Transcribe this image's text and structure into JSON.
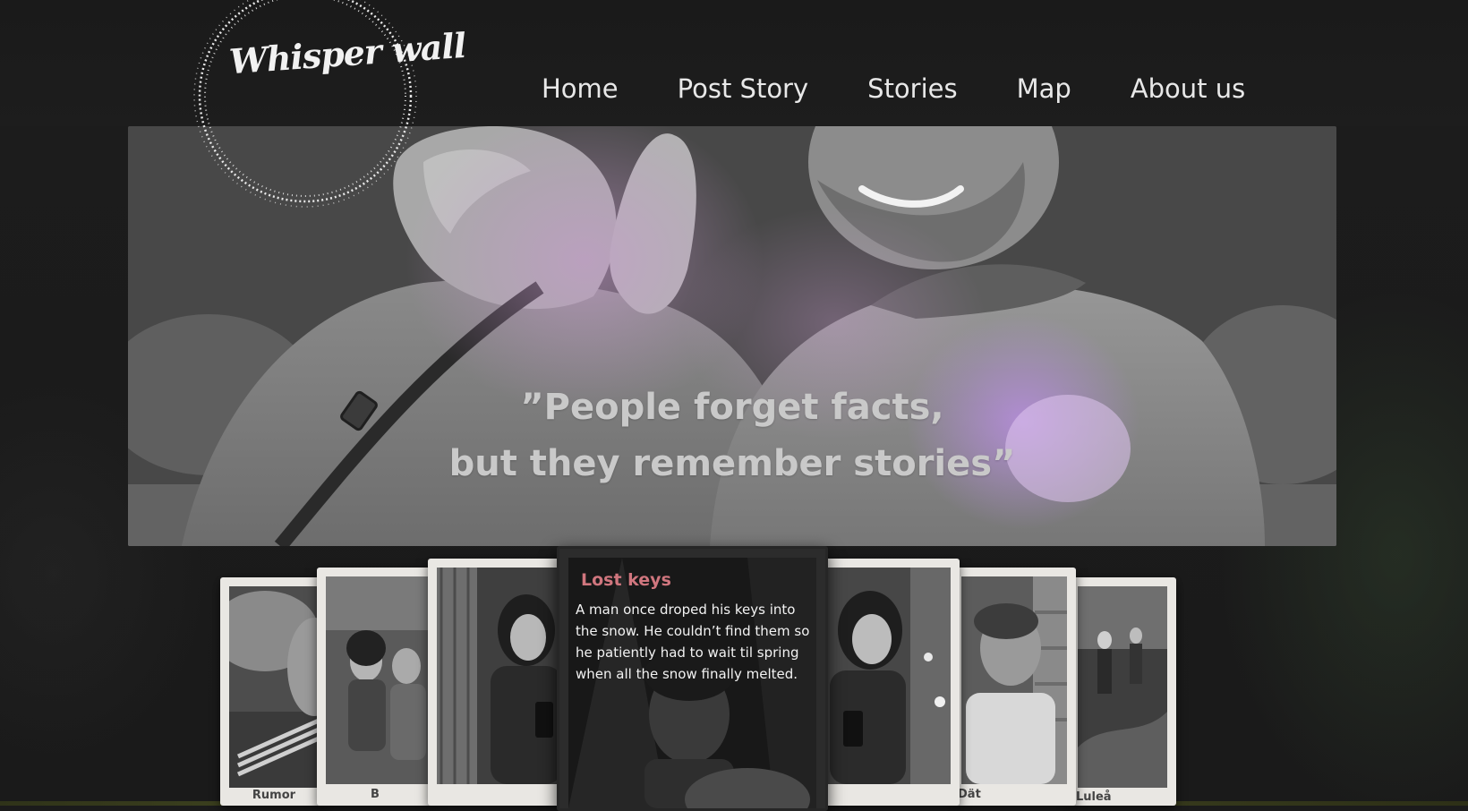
{
  "brand": {
    "name": "Whisper wall"
  },
  "nav": {
    "items": [
      {
        "label": "Home"
      },
      {
        "label": "Post Story"
      },
      {
        "label": "Stories"
      },
      {
        "label": "Map"
      },
      {
        "label": "About us"
      }
    ]
  },
  "hero": {
    "quote_line1": "”People forget facts,",
    "quote_line2": "but they remember stories”"
  },
  "carousel": {
    "featured": {
      "title": "Lost keys",
      "body": "A man once droped his keys into the snow. He couldn’t find them so he patiently had to wait til spring when all the snow finally melted."
    },
    "cards": [
      {
        "caption": "Rumor"
      },
      {
        "caption": "B"
      },
      {
        "caption": ""
      },
      {
        "caption": ""
      },
      {
        "caption": "Dät"
      },
      {
        "caption": "Luleå"
      }
    ]
  },
  "colors": {
    "background": "#1b1b1b",
    "nav_text": "#e8e8e8",
    "featured_title": "#d0767e",
    "accent_purple": "#b58fd6"
  }
}
